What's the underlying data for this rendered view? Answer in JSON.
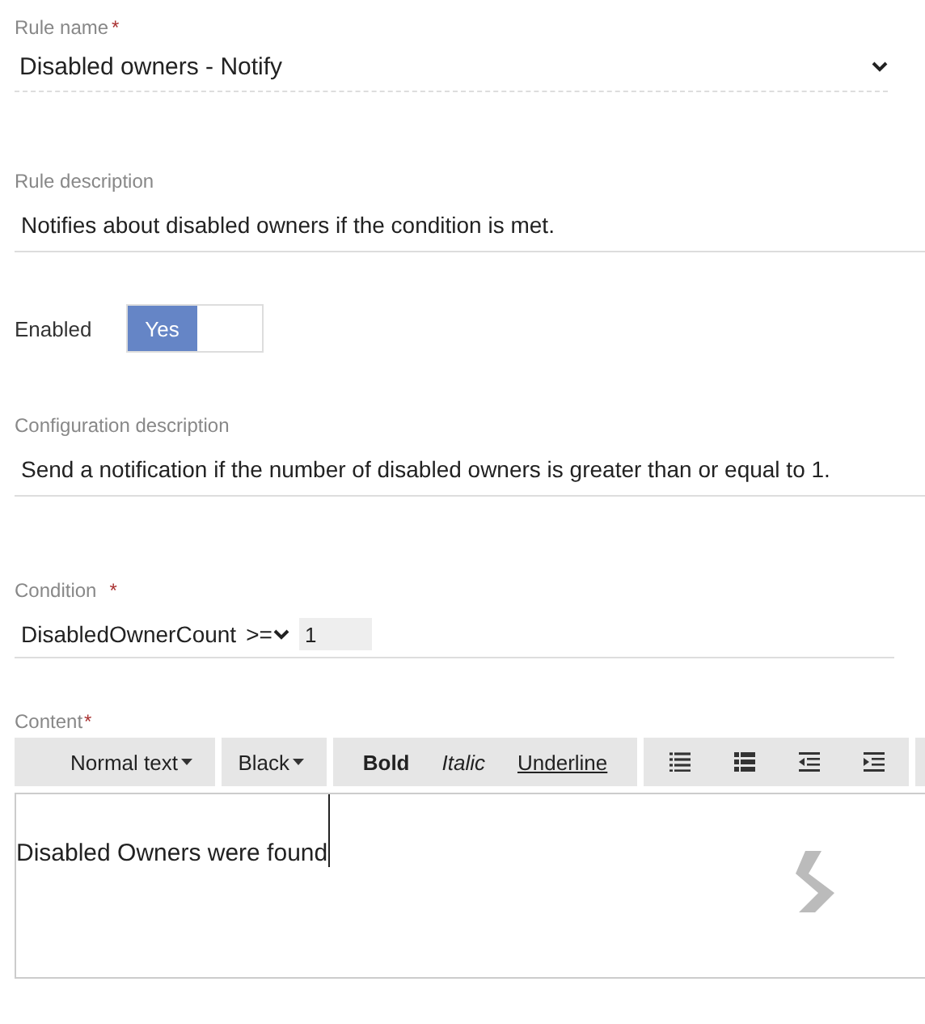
{
  "rule_name": {
    "label": "Rule name",
    "required_mark": "*",
    "value": "Disabled owners - Notify"
  },
  "rule_description": {
    "label": "Rule description",
    "value": "Notifies about disabled owners if the condition is met."
  },
  "enabled": {
    "label": "Enabled",
    "toggle": {
      "label": "Yes",
      "on": true
    }
  },
  "configuration_description": {
    "label": "Configuration description",
    "value": "Send a notification if the number of disabled owners is greater than or equal to 1."
  },
  "condition": {
    "label": "Condition",
    "required_mark": "*",
    "variable": "DisabledOwnerCount",
    "operator": ">=",
    "value": "1"
  },
  "content": {
    "label": "Content",
    "required_mark": "*",
    "toolbar": [
      {
        "items": [
          {
            "kind": "dropdown",
            "label": "Normal text"
          }
        ]
      },
      {
        "items": [
          {
            "kind": "dropdown",
            "label": "Black"
          }
        ]
      },
      {
        "items": [
          {
            "kind": "bold",
            "label": "Bold"
          },
          {
            "kind": "italic",
            "label": "Italic"
          },
          {
            "kind": "underline",
            "label": "Underline"
          }
        ]
      },
      {
        "items": [
          {
            "kind": "list"
          },
          {
            "kind": "bold-list"
          },
          {
            "kind": "outdent"
          },
          {
            "kind": "indent"
          }
        ]
      }
    ],
    "text": "Disabled Owners were found"
  }
}
